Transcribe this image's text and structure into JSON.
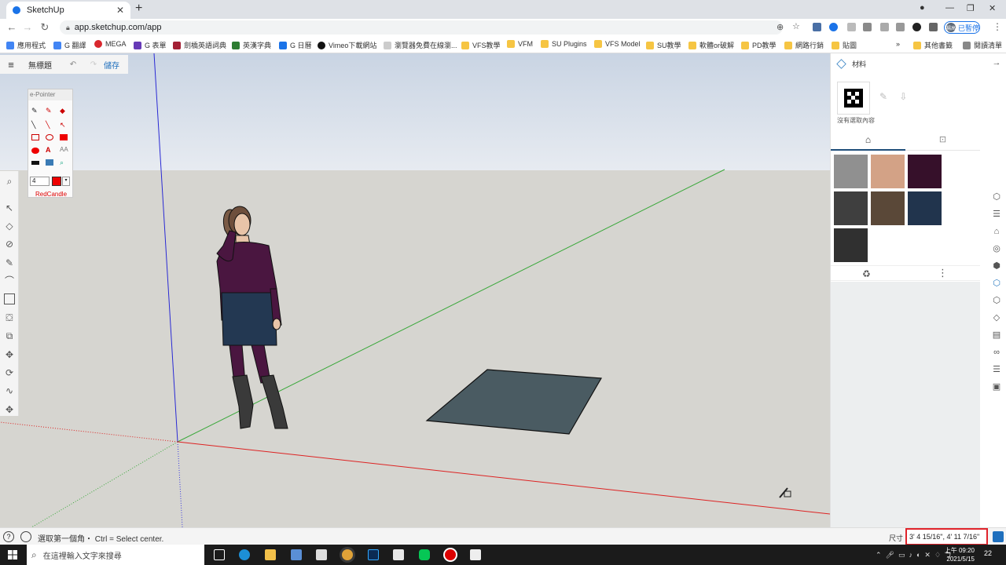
{
  "browser": {
    "tab_title": "SketchUp",
    "url": "app.sketchup.com/app",
    "profile_label": "已暫停",
    "profile_initials": "楊高"
  },
  "bookmarks": [
    {
      "label": "應用程式"
    },
    {
      "label": "G 翻譯"
    },
    {
      "label": "MEGA"
    },
    {
      "label": "G 表單"
    },
    {
      "label": "劍橋英語詞典"
    },
    {
      "label": "英漢字典"
    },
    {
      "label": "G 日曆"
    },
    {
      "label": "Vimeo下載網站"
    },
    {
      "label": "瀏覽器免費在線瀏..."
    },
    {
      "label": "VFS教學"
    },
    {
      "label": "VFM"
    },
    {
      "label": "SU Plugins"
    },
    {
      "label": "VFS Model"
    },
    {
      "label": "SU教學"
    },
    {
      "label": "軟體or破解"
    },
    {
      "label": "PD教學"
    },
    {
      "label": "網路行銷"
    },
    {
      "label": "貼圖"
    },
    {
      "label": "»"
    },
    {
      "label": "其他書籤"
    },
    {
      "label": "閱讀清單"
    }
  ],
  "sketchup": {
    "doc_title": "無標題",
    "save_label": "儲存",
    "epointer_title": "e-Pointer",
    "epointer_size": "4",
    "epointer_brand": "RedCandle",
    "panel_title": "材料",
    "no_selection": "沒有選取內容",
    "swatches": [
      "#909090",
      "#d3a286",
      "#36102a",
      "#3f3f3f",
      "#5a4838",
      "#21344d",
      "#303030"
    ],
    "status_message": "選取第一個角・ Ctrl = Select center.",
    "measure_label": "尺寸",
    "measure_value": "3' 4 15/16\", 4' 11 7/16\""
  },
  "taskbar": {
    "search_placeholder": "在這裡輸入文字來搜尋",
    "time": "上午 09:20",
    "date": "2021/5/15",
    "notif_count": "22"
  }
}
